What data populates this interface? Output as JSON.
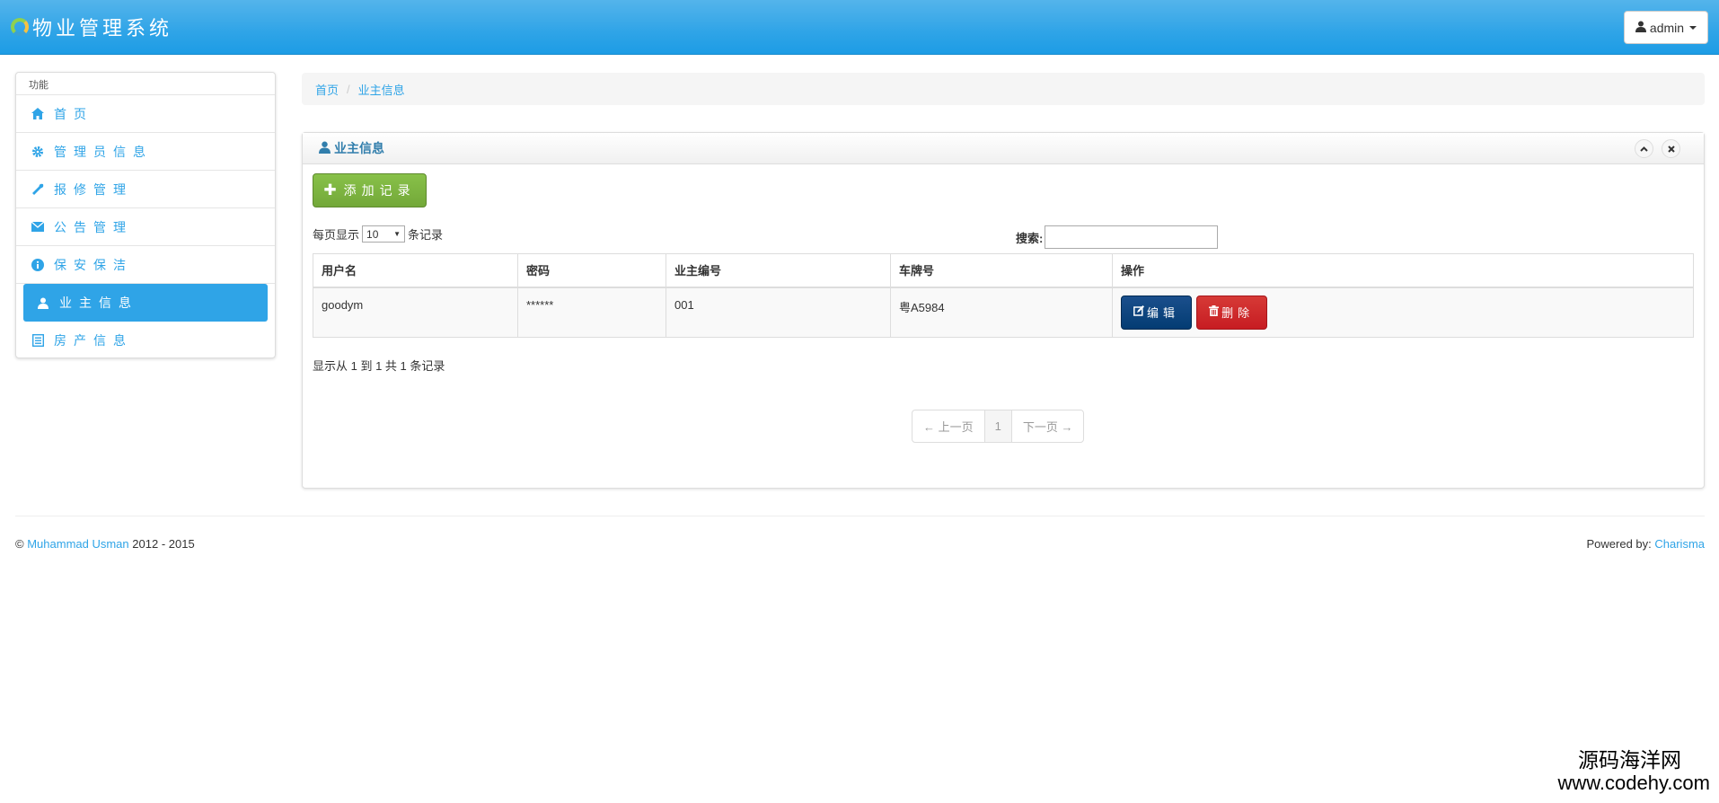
{
  "navbar": {
    "brand": "物业管理系统",
    "user_label": "admin"
  },
  "sidebar": {
    "header": "功能",
    "items": [
      {
        "label": "首页",
        "icon": "home-icon"
      },
      {
        "label": "管理员信息",
        "icon": "gear-icon"
      },
      {
        "label": "报修管理",
        "icon": "wrench-icon"
      },
      {
        "label": "公告管理",
        "icon": "envelope-icon"
      },
      {
        "label": "保安保洁",
        "icon": "info-icon"
      },
      {
        "label": "业主信息",
        "icon": "user-icon",
        "active": true
      },
      {
        "label": "房产信息",
        "icon": "list-icon"
      }
    ]
  },
  "breadcrumb": {
    "home": "首页",
    "current": "业主信息"
  },
  "box": {
    "title": "业主信息",
    "add_button": "添加记录",
    "length_prefix": "每页显示",
    "length_value": "10",
    "length_suffix": "条记录",
    "search_label": "搜索:",
    "search_value": ""
  },
  "table": {
    "headers": [
      "用户名",
      "密码",
      "业主编号",
      "车牌号",
      "操作"
    ],
    "rows": [
      {
        "username": "goodym",
        "password": "******",
        "owner_id": "001",
        "plate": "粤A5984"
      }
    ],
    "edit_label": "编辑",
    "delete_label": "删除"
  },
  "info_text": "显示从 1 到 1 共 1 条记录",
  "pager": {
    "prev": "← 上一页",
    "page": "1",
    "next": "下一页 →"
  },
  "footer": {
    "copyright_symbol": "©",
    "author": "Muhammad Usman",
    "years": "2012 - 2015",
    "powered_prefix": "Powered by:",
    "powered_link": "Charisma"
  },
  "watermark": {
    "line1": "源码海洋网",
    "line2": "www.codehy.com"
  },
  "colors": {
    "primary": "#2fa4e7",
    "success": "#73a839",
    "danger": "#c71c22",
    "edit": "#033c73"
  }
}
